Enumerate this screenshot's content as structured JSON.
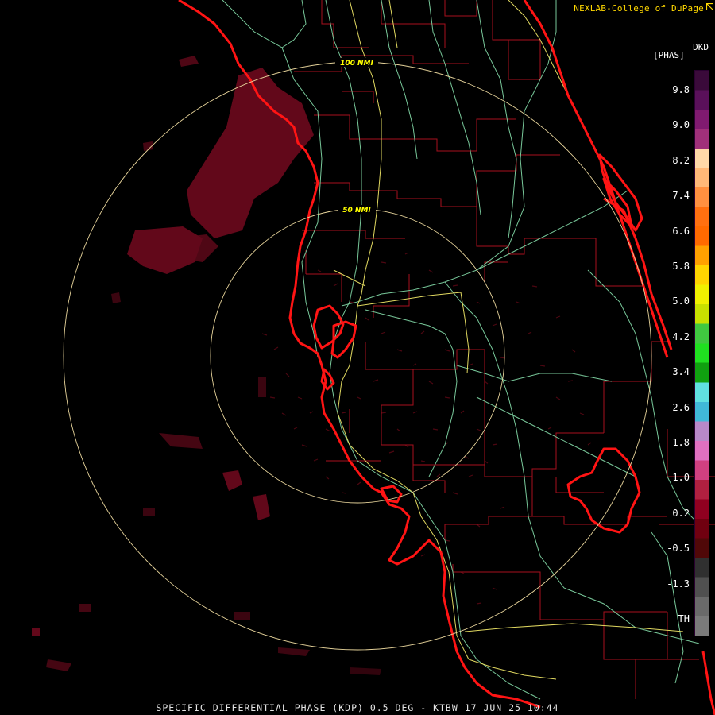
{
  "header": {
    "credit": "NEXLAB-College of DuPage"
  },
  "legend": {
    "product_code": "DKD",
    "unit": "[PHAS]",
    "ticks": [
      "9.8",
      "9.0",
      "8.2",
      "7.4",
      "6.6",
      "5.8",
      "5.0",
      "4.2",
      "3.4",
      "2.6",
      "1.8",
      "1.0",
      "0.2",
      "-0.5",
      "-1.3",
      "TH"
    ],
    "colors": [
      "#3a0a3a",
      "#5a105a",
      "#801a70",
      "#a0307a",
      "#ffd8a8",
      "#ffb878",
      "#ff9040",
      "#ff7010",
      "#ff6a00",
      "#ffa000",
      "#ffd400",
      "#f0f000",
      "#c8e000",
      "#40c840",
      "#20e020",
      "#10a010",
      "#60e0e0",
      "#40b8d8",
      "#b888c8",
      "#e070c0",
      "#d04080",
      "#b02040",
      "#900020",
      "#700010",
      "#500808",
      "#303030",
      "#505050",
      "#6a6a6a",
      "#7a7a7a"
    ]
  },
  "rings": [
    {
      "label": "100 NMI"
    },
    {
      "label": "50 NMI"
    }
  ],
  "footer": {
    "caption": "SPECIFIC DIFFERENTIAL PHASE (KDP) 0.5 DEG - KTBW 17 JUN 25 10:44"
  },
  "colors": {
    "coastline": "#ff1010",
    "county_lines": "#b0101a",
    "highways": "#e8e05a",
    "roads": "#80d0a0",
    "range_rings": "#f0d890",
    "echo": "#7a0a20"
  }
}
